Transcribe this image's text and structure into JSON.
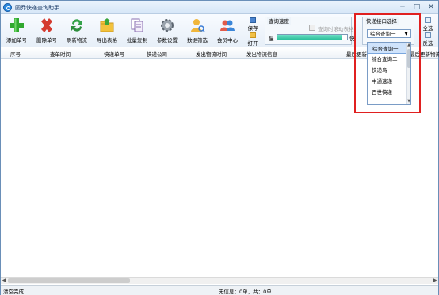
{
  "window": {
    "title": "圆乔快递查询助手",
    "controls": [
      "─",
      "□",
      "✕"
    ]
  },
  "toolbar": {
    "buttons": [
      {
        "label": "添加单号",
        "icon": "plus-icon"
      },
      {
        "label": "删除单号",
        "icon": "delete-x-icon"
      },
      {
        "label": "刷新物流",
        "icon": "refresh-icon"
      },
      {
        "label": "导出表格",
        "icon": "export-folder-icon"
      },
      {
        "label": "批量复制",
        "icon": "copy-icon"
      },
      {
        "label": "参数设置",
        "icon": "gear-icon"
      },
      {
        "label": "数据筛选",
        "icon": "filter-person-icon"
      },
      {
        "label": "会员中心",
        "icon": "member-icon"
      }
    ],
    "save_label": "保存",
    "open_label": "打开",
    "query_speed": {
      "title": "查询速度",
      "slow": "慢",
      "fast": "快",
      "progress": 0.92,
      "checkbox_label": "查询时滚动表格"
    },
    "api_select": {
      "title": "快递接口选择",
      "selected": "综合查询一",
      "options": [
        "综合查询一",
        "综合查询二",
        "快递鸟",
        "中通速递",
        "百世快递"
      ]
    },
    "select_all_label": "全选",
    "invert_label": "反选"
  },
  "grid": {
    "columns": [
      "序号",
      "查单时间",
      "快递单号",
      "快递公司",
      "发出物流时间",
      "发出物流信息",
      "最后更新",
      "最后更新物流"
    ]
  },
  "status": {
    "left": "清空完成",
    "center": "无信息：0单，共：0单"
  },
  "colors": {
    "accent": "#2c8be0",
    "highlight": "#e02020"
  }
}
